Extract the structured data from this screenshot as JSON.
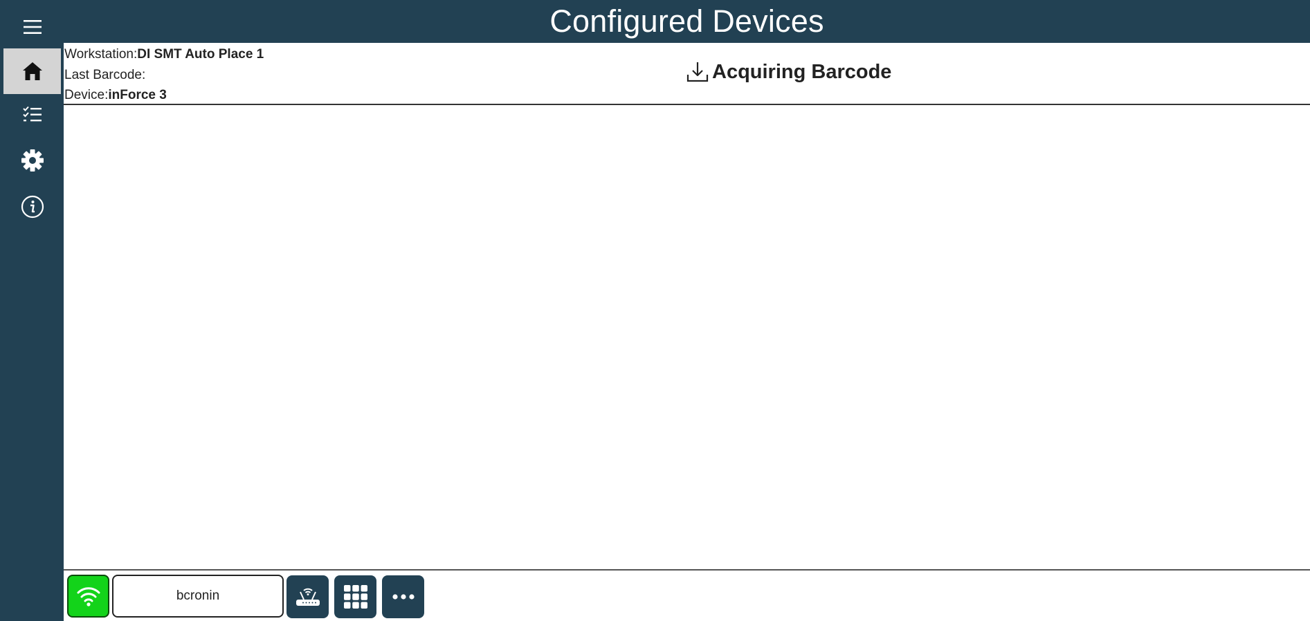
{
  "app": {
    "title": "Configured Devices"
  },
  "sidebar": {
    "items": [
      {
        "name": "menu",
        "icon": "hamburger-menu-icon"
      },
      {
        "name": "home",
        "icon": "home-icon",
        "active": true
      },
      {
        "name": "tasks",
        "icon": "checklist-icon"
      },
      {
        "name": "settings",
        "icon": "gear-icon"
      },
      {
        "name": "info",
        "icon": "info-icon"
      }
    ],
    "background": "#224153",
    "active_background": "#d4d4d4"
  },
  "info": {
    "workstation_label": "Workstation:",
    "workstation_value": "DI SMT Auto Place 1",
    "last_barcode_label": "Last Barcode:",
    "last_barcode_value": "",
    "device_label": "Device:",
    "device_value": "inForce 3"
  },
  "status": {
    "icon": "download-icon",
    "text": "Acquiring Barcode"
  },
  "footer": {
    "wifi_status_color": "#13d31a",
    "username": "bcronin",
    "buttons": [
      {
        "name": "router",
        "icon": "router-icon"
      },
      {
        "name": "keypad",
        "icon": "grid-icon"
      },
      {
        "name": "more",
        "icon": "more-horizontal-icon"
      }
    ]
  }
}
